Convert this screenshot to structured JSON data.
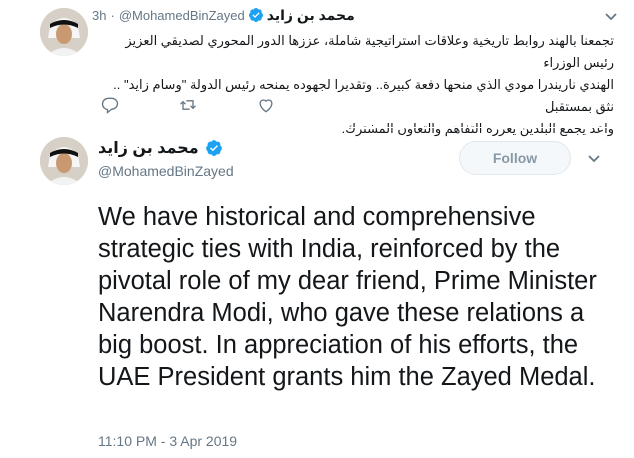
{
  "reply_tweet": {
    "author_name": "محمد بن زايد",
    "handle": "@MohamedBinZayed",
    "separator": "·",
    "time": "3h",
    "text_lines": [
      "تجمعنا بالهند روابط تاريخية وعلاقات استراتيجية شاملة، عززها الدور المحوري لصديقي العزيز رئيس الوزراء",
      "الهندي ناريندرا مودي الذي منحها دفعة كبيرة.. وتقديرا لجهوده يمنحه رئيس الدولة \"وسام زايد\" .. نثق بمستقبل",
      "واعد يجمع البلدين يعززه التفاهم والتعاون المشترك."
    ],
    "icons": [
      "chevron-down-icon",
      "reply-icon",
      "retweet-icon",
      "like-icon",
      "verified-icon"
    ]
  },
  "main_tweet": {
    "author_name": "محمد بن زايد",
    "handle": "@MohamedBinZayed",
    "follow_label": "Follow",
    "text": "We have historical and comprehensive strategic ties with India, reinforced by the pivotal role of my dear friend, Prime Minister Narendra Modi, who gave these relations a big boost. In appreciation of his efforts, the UAE President grants him the Zayed Medal.",
    "timestamp": "11:10 PM - 3 Apr 2019"
  },
  "colors": {
    "verified": "#1da1f2",
    "muted": "#657786",
    "icon": "#657786",
    "follow_border": "#e1e8ed"
  }
}
